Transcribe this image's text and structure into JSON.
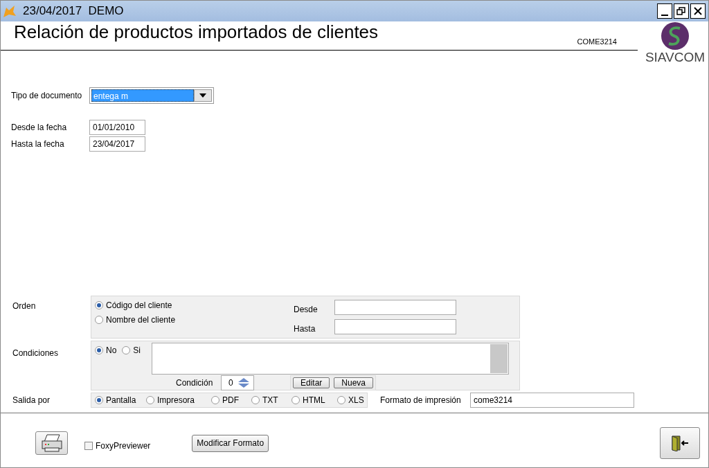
{
  "window": {
    "title": "23/04/2017  DEMO"
  },
  "heading": "Relación de productos importados de clientes",
  "code": "COME3214",
  "logo": {
    "text": "SIAVCOM"
  },
  "tipo": {
    "label": "Tipo de documento",
    "value": "entega m"
  },
  "dates": [
    {
      "label": "Desde la fecha",
      "value": "01/01/2010"
    },
    {
      "label": "Hasta la fecha",
      "value": "23/04/2017"
    }
  ],
  "orden": {
    "label": "Orden",
    "options": [
      {
        "label": "Código del cliente",
        "selected": true
      },
      {
        "label": "Nombre del cliente",
        "selected": false
      }
    ],
    "range": [
      {
        "label": "Desde"
      },
      {
        "label": "Hasta"
      }
    ]
  },
  "condiciones": {
    "label": "Condiciones",
    "options": [
      {
        "label": "No",
        "selected": true
      },
      {
        "label": "Si",
        "selected": false
      }
    ],
    "condicion_label": "Condición",
    "condicion_value": "0",
    "buttons": [
      "Editar",
      "Nueva"
    ]
  },
  "salida": {
    "label": "Salida por",
    "options": [
      {
        "label": "Pantalla",
        "selected": true
      },
      {
        "label": "Impresora",
        "selected": false
      },
      {
        "label": "PDF",
        "selected": false
      },
      {
        "label": "TXT",
        "selected": false
      },
      {
        "label": "HTML",
        "selected": false
      },
      {
        "label": "XLS",
        "selected": false
      }
    ],
    "formato_label": "Formato de impresión",
    "formato_value": "come3214"
  },
  "footer": {
    "foxy": {
      "label": "FoxyPreviewer",
      "checked": false
    },
    "modify_button": "Modificar Formato"
  }
}
